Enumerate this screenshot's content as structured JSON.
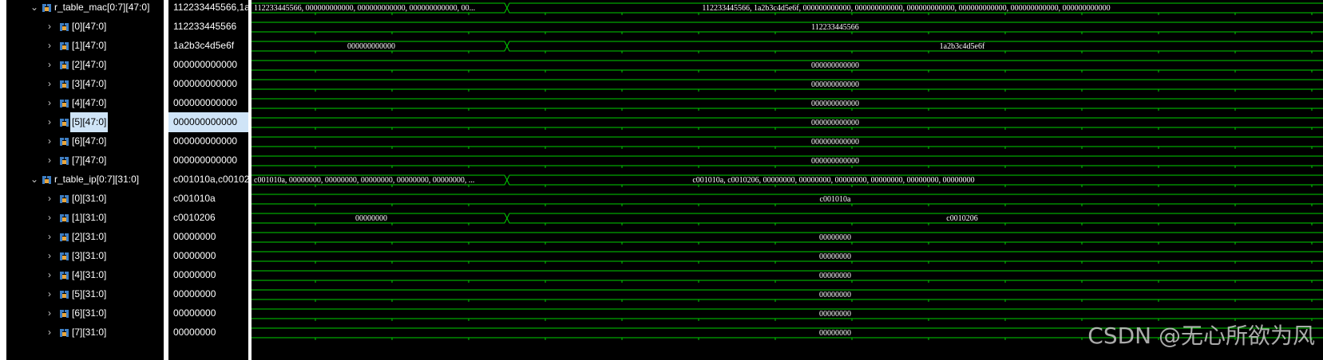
{
  "signals": [
    {
      "id": "r_table_mac",
      "name": "r_table_mac[0:7][47:0]",
      "value": "112233445566,1a2b3c4d5e6f,000000000000,000000000000,000000000000,000000000000,000000000000,000000000000",
      "level": 0,
      "expanded": true,
      "selected": false,
      "segments": [
        {
          "text": "112233445566, 000000000000, 000000000000, 000000000000, 00...",
          "align": "start"
        },
        {
          "text": "112233445566, 1a2b3c4d5e6f, 000000000000, 000000000000, 000000000000, 000000000000, 000000000000, 000000000000",
          "align": "middle"
        }
      ]
    },
    {
      "id": "mac0",
      "name": "[0][47:0]",
      "value": "112233445566",
      "level": 1,
      "expanded": false,
      "selected": false,
      "segments": [
        {
          "text": "112233445566",
          "align": "middle"
        }
      ]
    },
    {
      "id": "mac1",
      "name": "[1][47:0]",
      "value": "1a2b3c4d5e6f",
      "level": 1,
      "expanded": false,
      "selected": false,
      "segments": [
        {
          "text": "000000000000",
          "align": "middle"
        },
        {
          "text": "1a2b3c4d5e6f",
          "align": "middle"
        }
      ]
    },
    {
      "id": "mac2",
      "name": "[2][47:0]",
      "value": "000000000000",
      "level": 1,
      "expanded": false,
      "selected": false,
      "segments": [
        {
          "text": "000000000000",
          "align": "middle"
        }
      ]
    },
    {
      "id": "mac3",
      "name": "[3][47:0]",
      "value": "000000000000",
      "level": 1,
      "expanded": false,
      "selected": false,
      "segments": [
        {
          "text": "000000000000",
          "align": "middle"
        }
      ]
    },
    {
      "id": "mac4",
      "name": "[4][47:0]",
      "value": "000000000000",
      "level": 1,
      "expanded": false,
      "selected": false,
      "segments": [
        {
          "text": "000000000000",
          "align": "middle"
        }
      ]
    },
    {
      "id": "mac5",
      "name": "[5][47:0]",
      "value": "000000000000",
      "level": 1,
      "expanded": false,
      "selected": true,
      "segments": [
        {
          "text": "000000000000",
          "align": "middle"
        }
      ]
    },
    {
      "id": "mac6",
      "name": "[6][47:0]",
      "value": "000000000000",
      "level": 1,
      "expanded": false,
      "selected": false,
      "segments": [
        {
          "text": "000000000000",
          "align": "middle"
        }
      ]
    },
    {
      "id": "mac7",
      "name": "[7][47:0]",
      "value": "000000000000",
      "level": 1,
      "expanded": false,
      "selected": false,
      "segments": [
        {
          "text": "000000000000",
          "align": "middle"
        }
      ]
    },
    {
      "id": "r_table_ip",
      "name": "r_table_ip[0:7][31:0]",
      "value": "c001010a,c0010206,00000000,00000000,00000000,00000000,00000000,00000000",
      "level": 0,
      "expanded": true,
      "selected": false,
      "segments": [
        {
          "text": "c001010a, 00000000, 00000000, 00000000, 00000000, 00000000, ...",
          "align": "start"
        },
        {
          "text": "c001010a, c0010206, 00000000, 00000000, 00000000, 00000000, 00000000, 00000000",
          "align": "middle"
        }
      ]
    },
    {
      "id": "ip0",
      "name": "[0][31:0]",
      "value": "c001010a",
      "level": 1,
      "expanded": false,
      "selected": false,
      "segments": [
        {
          "text": "c001010a",
          "align": "middle"
        }
      ]
    },
    {
      "id": "ip1",
      "name": "[1][31:0]",
      "value": "c0010206",
      "level": 1,
      "expanded": false,
      "selected": false,
      "segments": [
        {
          "text": "00000000",
          "align": "middle"
        },
        {
          "text": "c0010206",
          "align": "middle"
        }
      ]
    },
    {
      "id": "ip2",
      "name": "[2][31:0]",
      "value": "00000000",
      "level": 1,
      "expanded": false,
      "selected": false,
      "segments": [
        {
          "text": "00000000",
          "align": "middle"
        }
      ]
    },
    {
      "id": "ip3",
      "name": "[3][31:0]",
      "value": "00000000",
      "level": 1,
      "expanded": false,
      "selected": false,
      "segments": [
        {
          "text": "00000000",
          "align": "middle"
        }
      ]
    },
    {
      "id": "ip4",
      "name": "[4][31:0]",
      "value": "00000000",
      "level": 1,
      "expanded": false,
      "selected": false,
      "segments": [
        {
          "text": "00000000",
          "align": "middle"
        }
      ]
    },
    {
      "id": "ip5",
      "name": "[5][31:0]",
      "value": "00000000",
      "level": 1,
      "expanded": false,
      "selected": false,
      "segments": [
        {
          "text": "00000000",
          "align": "middle"
        }
      ]
    },
    {
      "id": "ip6",
      "name": "[6][31:0]",
      "value": "00000000",
      "level": 1,
      "expanded": false,
      "selected": false,
      "segments": [
        {
          "text": "00000000",
          "align": "middle"
        }
      ]
    },
    {
      "id": "ip7",
      "name": "[7][31:0]",
      "value": "00000000",
      "level": 1,
      "expanded": false,
      "selected": false,
      "segments": [
        {
          "text": "00000000",
          "align": "middle"
        }
      ]
    }
  ],
  "icons": {
    "expanded": "chevron-down-icon",
    "collapsed": "chevron-right-icon",
    "signal": "bus-signal-icon"
  },
  "colors": {
    "wave": "#00d000",
    "background": "#000000",
    "text": "#ffffff",
    "selection": "#cfe4f7",
    "icon_blue": "#3f7fc4",
    "icon_orange": "#e8a53c"
  },
  "watermark": "CSDN @无心所欲为风"
}
